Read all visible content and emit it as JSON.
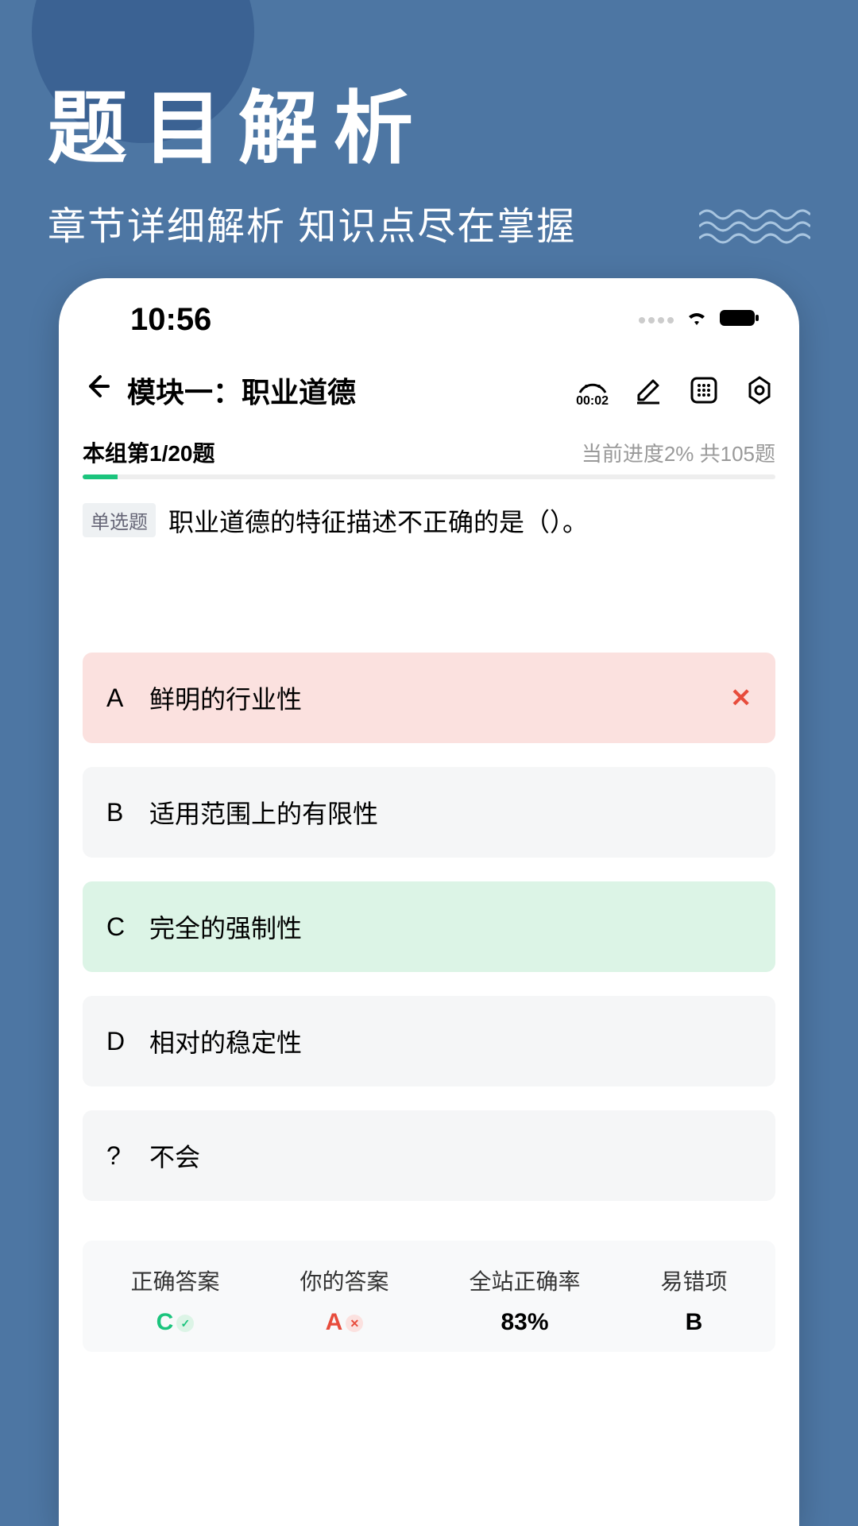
{
  "hero": {
    "title": "题目解析",
    "subtitle": "章节详细解析 知识点尽在掌握"
  },
  "status": {
    "time": "10:56"
  },
  "nav": {
    "title": "模块一：职业道德",
    "timer": "00:02"
  },
  "progress": {
    "left": "本组第1/20题",
    "right": "当前进度2%  共105题"
  },
  "question": {
    "tag": "单选题",
    "text": "职业道德的特征描述不正确的是（）。"
  },
  "options": [
    {
      "letter": "A",
      "text": "鲜明的行业性",
      "state": "wrong"
    },
    {
      "letter": "B",
      "text": "适用范围上的有限性",
      "state": ""
    },
    {
      "letter": "C",
      "text": "完全的强制性",
      "state": "correct"
    },
    {
      "letter": "D",
      "text": "相对的稳定性",
      "state": ""
    },
    {
      "letter": "?",
      "text": "不会",
      "state": ""
    }
  ],
  "stats": {
    "correct_label": "正确答案",
    "correct_value": "C",
    "your_label": "你的答案",
    "your_value": "A",
    "rate_label": "全站正确率",
    "rate_value": "83%",
    "miss_label": "易错项",
    "miss_value": "B"
  }
}
